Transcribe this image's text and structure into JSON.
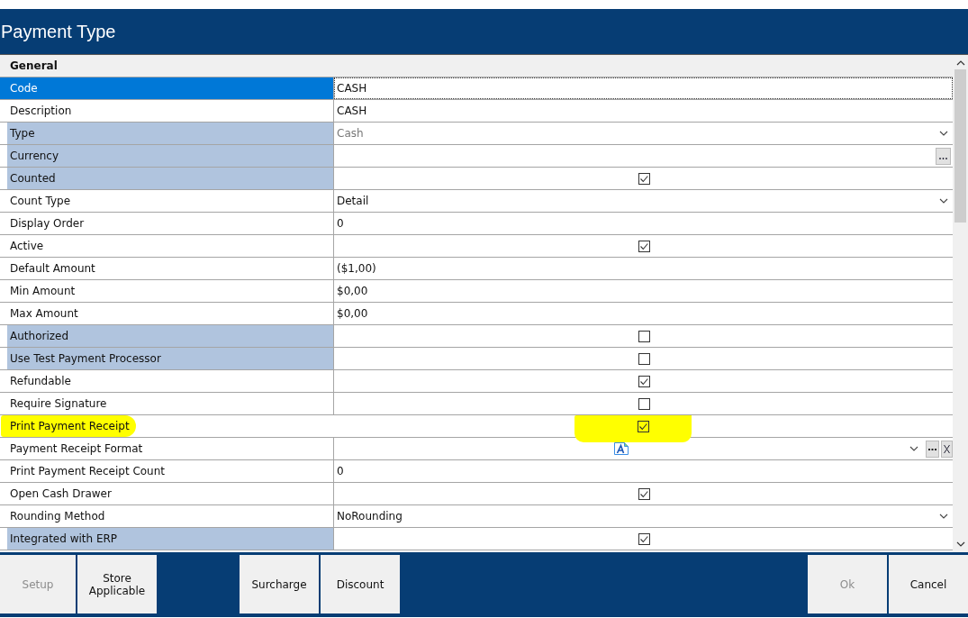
{
  "window": {
    "title": "Payment Type"
  },
  "grid": {
    "category": "General",
    "rows": [
      {
        "label": "Code",
        "kind": "text",
        "value": "CASH",
        "selected": true,
        "shaded": false
      },
      {
        "label": "Description",
        "kind": "text",
        "value": "CASH",
        "selected": false,
        "shaded": false
      },
      {
        "label": "Type",
        "kind": "dropdown",
        "value": "Cash",
        "disabled": true,
        "selected": false,
        "shaded": true
      },
      {
        "label": "Currency",
        "kind": "ellipsis",
        "value": "",
        "selected": false,
        "shaded": true
      },
      {
        "label": "Counted",
        "kind": "checkbox",
        "checked": true,
        "selected": false,
        "shaded": true
      },
      {
        "label": "Count Type",
        "kind": "dropdown",
        "value": "Detail",
        "disabled": false,
        "selected": false,
        "shaded": false
      },
      {
        "label": "Display Order",
        "kind": "text",
        "value": "0",
        "selected": false,
        "shaded": false
      },
      {
        "label": "Active",
        "kind": "checkbox",
        "checked": true,
        "selected": false,
        "shaded": false
      },
      {
        "label": "Default Amount",
        "kind": "text",
        "value": "($1,00)",
        "selected": false,
        "shaded": false
      },
      {
        "label": "Min Amount",
        "kind": "text",
        "value": "$0,00",
        "selected": false,
        "shaded": false
      },
      {
        "label": "Max Amount",
        "kind": "text",
        "value": "$0,00",
        "selected": false,
        "shaded": false
      },
      {
        "label": "Authorized",
        "kind": "checkbox",
        "checked": false,
        "selected": false,
        "shaded": true
      },
      {
        "label": "Use Test Payment Processor",
        "kind": "checkbox",
        "checked": false,
        "selected": false,
        "shaded": true
      },
      {
        "label": "Refundable",
        "kind": "checkbox",
        "checked": true,
        "selected": false,
        "shaded": false
      },
      {
        "label": "Require Signature",
        "kind": "checkbox",
        "checked": false,
        "selected": false,
        "shaded": false
      },
      {
        "label": "Print Payment Receipt",
        "kind": "checkbox",
        "checked": true,
        "selected": false,
        "shaded": false,
        "highlighted": true
      },
      {
        "label": "Payment Receipt Format",
        "kind": "format",
        "selected": false,
        "shaded": false
      },
      {
        "label": "Print Payment Receipt Count",
        "kind": "text",
        "value": "0",
        "selected": false,
        "shaded": false
      },
      {
        "label": "Open Cash Drawer",
        "kind": "checkbox",
        "checked": true,
        "selected": false,
        "shaded": false
      },
      {
        "label": "Rounding Method",
        "kind": "dropdown",
        "value": "NoRounding",
        "disabled": false,
        "selected": false,
        "shaded": false
      },
      {
        "label": "Integrated with ERP",
        "kind": "checkbox",
        "checked": true,
        "selected": false,
        "shaded": true
      }
    ]
  },
  "button_groups": [
    [
      {
        "label": "Setup",
        "disabled": true
      },
      {
        "label": "Store Applicable",
        "disabled": false
      }
    ],
    [
      {
        "label": "Surcharge",
        "disabled": false
      },
      {
        "label": "Discount",
        "disabled": false
      }
    ],
    [
      {
        "label": "Ok",
        "disabled": true
      },
      {
        "label": "Cancel",
        "disabled": false
      }
    ]
  ]
}
